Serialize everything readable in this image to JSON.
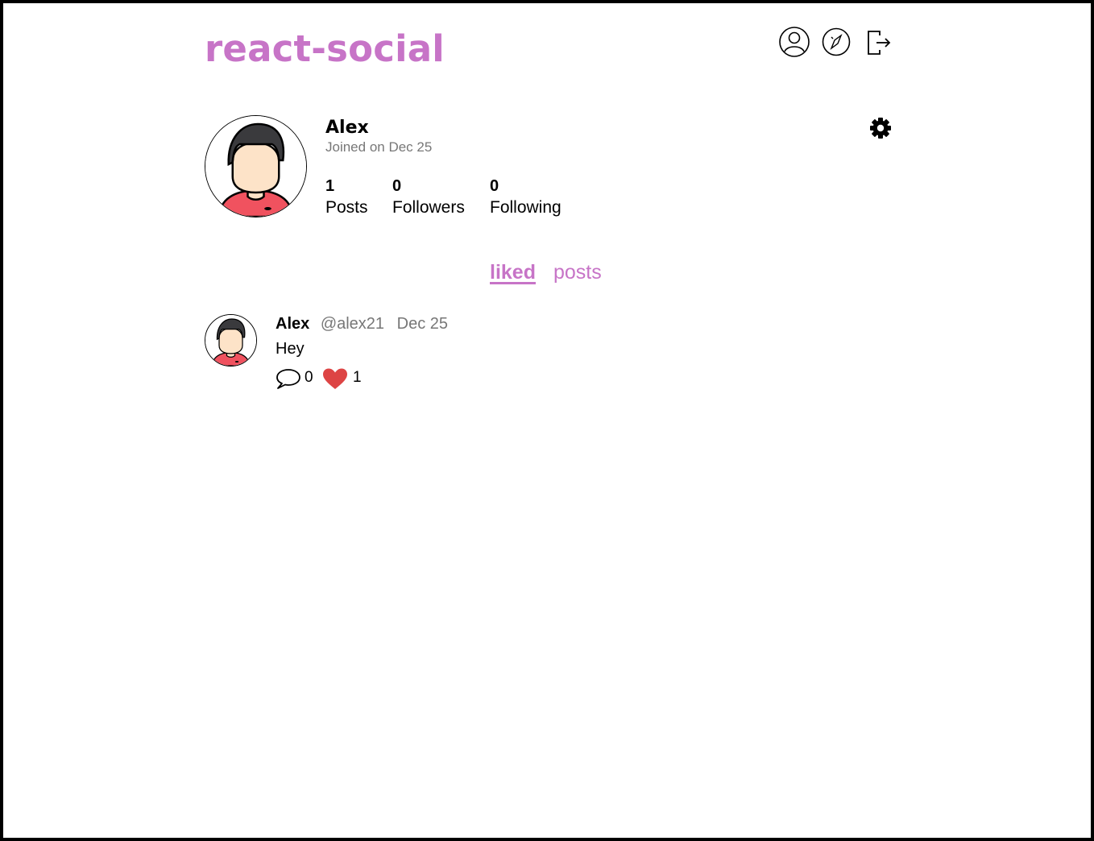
{
  "header": {
    "brand": "react-social",
    "nav": [
      {
        "icon": "user-icon"
      },
      {
        "icon": "compass-icon"
      },
      {
        "icon": "logout-icon"
      }
    ]
  },
  "profile": {
    "name": "Alex",
    "joined": "Joined on Dec 25",
    "stats": [
      {
        "value": "1",
        "label": "Posts"
      },
      {
        "value": "0",
        "label": "Followers"
      },
      {
        "value": "0",
        "label": "Following"
      }
    ],
    "settings_icon": "gear-icon"
  },
  "tabs": [
    {
      "label": "liked",
      "active": true
    },
    {
      "label": "posts",
      "active": false
    }
  ],
  "posts": [
    {
      "author": "Alex",
      "handle": "@alex21",
      "date": "Dec 25",
      "body": "Hey",
      "comments": "0",
      "likes": "1"
    }
  ],
  "colors": {
    "accent": "#c774c7",
    "heart": "#dd4444",
    "muted": "#777777"
  }
}
